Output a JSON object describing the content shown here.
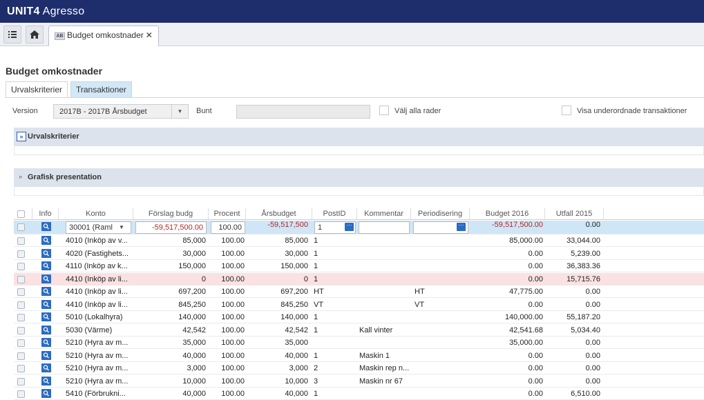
{
  "app": {
    "brand_bold": "UNIT4",
    "brand_rest": " Agresso"
  },
  "tabs": [
    {
      "badge": "AB",
      "label": "Budget omkostnader"
    }
  ],
  "page": {
    "title": "Budget omkostnader",
    "subtabs": [
      "Urvalskriterier",
      "Transaktioner"
    ],
    "active_subtab": 1
  },
  "filters": {
    "version_label": "Version",
    "version_value": "2017B - 2017B Årsbudget",
    "bunt_label": "Bunt",
    "bunt_value": "",
    "select_all_label": "Välj alla rader",
    "show_sub_label": "Visa underordnade transaktioner"
  },
  "panels": {
    "criteria": "Urvalskriterier",
    "graph": "Grafisk presentation"
  },
  "grid": {
    "columns": [
      "Info",
      "Konto",
      "Förslag budg",
      "Procent",
      "Årsbudget",
      "PostID",
      "Kommentar",
      "Periodisering",
      "Budget 2016",
      "Utfall 2015"
    ],
    "edit_row": {
      "konto": "30001 (Raml",
      "forslag": "-59,517,500.00",
      "procent": "100.00",
      "arsbudget": "-59,517,500",
      "postid": "1",
      "kommentar": "",
      "periodisering": "",
      "budget2016": "-59,517,500.00",
      "utfall2015": "0.00"
    },
    "rows": [
      {
        "konto": "4010 (Inköp av v...",
        "forslag": "85,000",
        "procent": "100.00",
        "arsbudget": "85,000",
        "postid": "1",
        "kommentar": "",
        "periodisering": "",
        "budget2016": "85,000.00",
        "utfall2015": "33,044.00"
      },
      {
        "konto": "4020 (Fastighets...",
        "forslag": "30,000",
        "procent": "100.00",
        "arsbudget": "30,000",
        "postid": "1",
        "kommentar": "",
        "periodisering": "",
        "budget2016": "0.00",
        "utfall2015": "5,239.00"
      },
      {
        "konto": "4110 (Inköp av k...",
        "forslag": "150,000",
        "procent": "100.00",
        "arsbudget": "150,000",
        "postid": "1",
        "kommentar": "",
        "periodisering": "",
        "budget2016": "0.00",
        "utfall2015": "36,383.36"
      },
      {
        "konto": "4410 (Inköp av li...",
        "forslag": "0",
        "procent": "100.00",
        "arsbudget": "0",
        "postid": "1",
        "kommentar": "",
        "periodisering": "",
        "budget2016": "0.00",
        "utfall2015": "15,715.76",
        "error": true
      },
      {
        "konto": "4410 (Inköp av li...",
        "forslag": "697,200",
        "procent": "100.00",
        "arsbudget": "697,200",
        "postid": "HT",
        "kommentar": "",
        "periodisering": "HT",
        "budget2016": "47,775.00",
        "utfall2015": "0.00"
      },
      {
        "konto": "4410 (Inköp av li...",
        "forslag": "845,250",
        "procent": "100.00",
        "arsbudget": "845,250",
        "postid": "VT",
        "kommentar": "",
        "periodisering": "VT",
        "budget2016": "0.00",
        "utfall2015": "0.00"
      },
      {
        "konto": "5010 (Lokalhyra)",
        "forslag": "140,000",
        "procent": "100.00",
        "arsbudget": "140,000",
        "postid": "1",
        "kommentar": "",
        "periodisering": "",
        "budget2016": "140,000.00",
        "utfall2015": "55,187.20"
      },
      {
        "konto": "5030 (Värme)",
        "forslag": "42,542",
        "procent": "100.00",
        "arsbudget": "42,542",
        "postid": "1",
        "kommentar": "Kall vinter",
        "periodisering": "",
        "budget2016": "42,541.68",
        "utfall2015": "5,034.40"
      },
      {
        "konto": "5210 (Hyra av m...",
        "forslag": "35,000",
        "procent": "100.00",
        "arsbudget": "35,000",
        "postid": "",
        "kommentar": "",
        "periodisering": "",
        "budget2016": "35,000.00",
        "utfall2015": "0.00"
      },
      {
        "konto": "5210 (Hyra av m...",
        "forslag": "40,000",
        "procent": "100.00",
        "arsbudget": "40,000",
        "postid": "1",
        "kommentar": "Maskin 1",
        "periodisering": "",
        "budget2016": "0.00",
        "utfall2015": "0.00"
      },
      {
        "konto": "5210 (Hyra av m...",
        "forslag": "3,000",
        "procent": "100.00",
        "arsbudget": "3,000",
        "postid": "2",
        "kommentar": "Maskin rep n...",
        "periodisering": "",
        "budget2016": "0.00",
        "utfall2015": "0.00"
      },
      {
        "konto": "5210 (Hyra av m...",
        "forslag": "10,000",
        "procent": "100.00",
        "arsbudget": "10,000",
        "postid": "3",
        "kommentar": "Maskin nr 67",
        "periodisering": "",
        "budget2016": "0.00",
        "utfall2015": "0.00"
      },
      {
        "konto": "5410 (Förbrukni...",
        "forslag": "40,000",
        "procent": "100.00",
        "arsbudget": "40,000",
        "postid": "1",
        "kommentar": "",
        "periodisering": "",
        "budget2016": "0.00",
        "utfall2015": "6,510.00"
      }
    ]
  },
  "icons": {
    "menu": "list-icon",
    "home": "home-icon",
    "info": "search-icon",
    "lookup": "ellipsis-icon",
    "dropdown": "chevron-down-icon",
    "collapse": "double-chevron-icon"
  }
}
